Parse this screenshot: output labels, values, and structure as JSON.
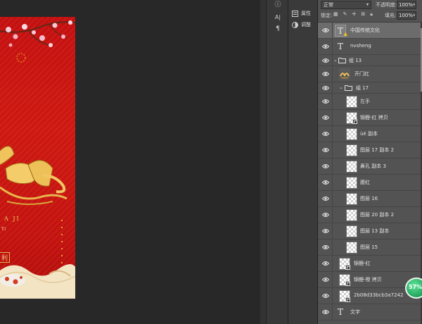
{
  "document_art": {
    "text_line1": "A JI",
    "text_line2": "Y)",
    "text_line3": "利"
  },
  "mini_toolbar": {
    "items": [
      {
        "icon": "info-icon",
        "glyph": "ⓘ"
      },
      {
        "icon": "character-icon",
        "glyph": "A|"
      },
      {
        "icon": "paragraph-icon",
        "glyph": "¶"
      }
    ]
  },
  "properties_panel": {
    "items": [
      {
        "label": "属性",
        "icon": "properties-icon"
      },
      {
        "label": "调整",
        "icon": "adjustments-icon"
      }
    ]
  },
  "layers_panel": {
    "blend_mode": "正常",
    "opacity_label": "不透明度:",
    "opacity_value": "100%",
    "lock_label": "锁定:",
    "fill_label": "填充:",
    "fill_value": "100%",
    "layers": [
      {
        "name": "中国传统文化",
        "kind": "text-warning",
        "indent": 0,
        "selected": true
      },
      {
        "name": "nvsheng",
        "kind": "text",
        "indent": 0,
        "selected": false
      },
      {
        "name": "组 13",
        "kind": "group",
        "indent": 0,
        "selected": false
      },
      {
        "name": "开门红",
        "kind": "image-gold",
        "indent": 1,
        "selected": false
      },
      {
        "name": "组 17",
        "kind": "group",
        "indent": 1,
        "selected": false
      },
      {
        "name": "左手",
        "kind": "pixel",
        "indent": 2,
        "selected": false
      },
      {
        "name": "锦鲤-红 拷贝",
        "kind": "smart",
        "indent": 2,
        "selected": false
      },
      {
        "name": "ùé 副本",
        "kind": "pixel",
        "indent": 2,
        "selected": false
      },
      {
        "name": "图层 17 副本 2",
        "kind": "pixel",
        "indent": 2,
        "selected": false
      },
      {
        "name": "鼻孔 副本 3",
        "kind": "pixel",
        "indent": 2,
        "selected": false
      },
      {
        "name": "腮红",
        "kind": "pixel",
        "indent": 2,
        "selected": false
      },
      {
        "name": "图层 16",
        "kind": "pixel",
        "indent": 2,
        "selected": false
      },
      {
        "name": "图层 20 副本 2",
        "kind": "pixel",
        "indent": 2,
        "selected": false
      },
      {
        "name": "图层 13 副本",
        "kind": "pixel",
        "indent": 2,
        "selected": false
      },
      {
        "name": "图层 15",
        "kind": "pixel",
        "indent": 2,
        "selected": false
      },
      {
        "name": "锦鲤-红",
        "kind": "smart",
        "indent": 1,
        "selected": false
      },
      {
        "name": "锦鲤-橙 拷贝",
        "kind": "smart",
        "indent": 1,
        "selected": false
      },
      {
        "name": "2b08d33bcb3a7242ad4f...",
        "kind": "smart",
        "indent": 1,
        "selected": false
      },
      {
        "name": "文字",
        "kind": "text",
        "indent": 0,
        "selected": false
      }
    ]
  },
  "performance_badge": "57%",
  "colors": {
    "canvas_bg": "#282828",
    "poster_red": "#c6100f",
    "gold": "#f2c766",
    "panel_bg": "#535353",
    "selected_row": "#6c6c6c"
  }
}
